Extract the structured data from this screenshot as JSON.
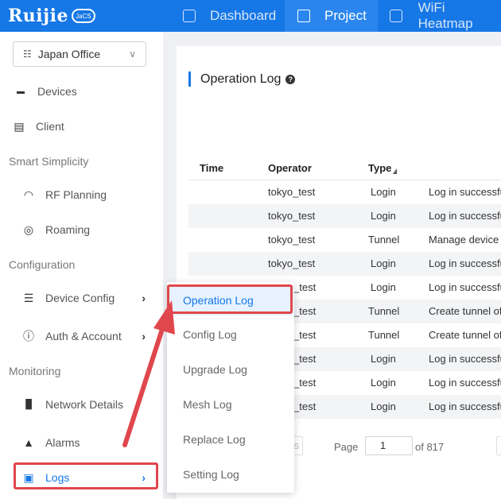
{
  "topbar": {
    "logo_text": "Ruijie",
    "logo_badge": "JaCS",
    "tabs": [
      {
        "label": "Dashboard",
        "icon": "dashboard-icon"
      },
      {
        "label": "Project",
        "icon": "cube-icon"
      },
      {
        "label": "WiFi Heatmap",
        "icon": "heatmap-icon"
      }
    ],
    "active_tab": "Project",
    "accent_color": "#1677e6"
  },
  "sidebar": {
    "site": "Japan Office",
    "items": [
      {
        "label": "Devices",
        "icon": "switch-icon"
      },
      {
        "label": "Client",
        "icon": "client-icon"
      },
      {
        "label": "RF Planning",
        "icon": "wifi-icon"
      },
      {
        "label": "Roaming",
        "icon": "globe-icon"
      },
      {
        "label": "Device Config",
        "icon": "sliders-icon"
      },
      {
        "label": "Auth & Account",
        "icon": "user-icon"
      },
      {
        "label": "Network Details",
        "icon": "chart-icon"
      },
      {
        "label": "Alarms",
        "icon": "bell-icon"
      },
      {
        "label": "Logs",
        "icon": "calendar-icon"
      }
    ],
    "sections": [
      "Smart Simplicity",
      "Configuration",
      "Monitoring"
    ]
  },
  "content": {
    "title": "Operation Log",
    "columns": [
      "Time",
      "Operator",
      "Type"
    ],
    "rows": [
      {
        "operator": "tokyo_test",
        "type": "Login",
        "desc": "Log in successfu"
      },
      {
        "operator": "tokyo_test",
        "type": "Login",
        "desc": "Log in successfu"
      },
      {
        "operator": "tokyo_test",
        "type": "Tunnel",
        "desc": "Manage device"
      },
      {
        "operator": "tokyo_test",
        "type": "Login",
        "desc": "Log in successfu"
      },
      {
        "operator": "_test",
        "type": "Login",
        "desc": "Log in successfu"
      },
      {
        "operator": "_test",
        "type": "Tunnel",
        "desc": "Create tunnel of"
      },
      {
        "operator": "_test",
        "type": "Tunnel",
        "desc": "Create tunnel of"
      },
      {
        "operator": "_test",
        "type": "Login",
        "desc": "Log in successfu"
      },
      {
        "operator": "_test",
        "type": "Login",
        "desc": "Log in successfu"
      },
      {
        "operator": "_test",
        "type": "Login",
        "desc": "Log in successfu"
      }
    ],
    "pager": {
      "prev_fragment": "s",
      "page_label": "Page",
      "page_value": "1",
      "total": "of 817"
    }
  },
  "dropdown": {
    "items": [
      "Operation Log",
      "Config Log",
      "Upgrade Log",
      "Mesh Log",
      "Replace Log",
      "Setting Log"
    ],
    "active": "Operation Log"
  },
  "annotation_color": "#e0474c"
}
